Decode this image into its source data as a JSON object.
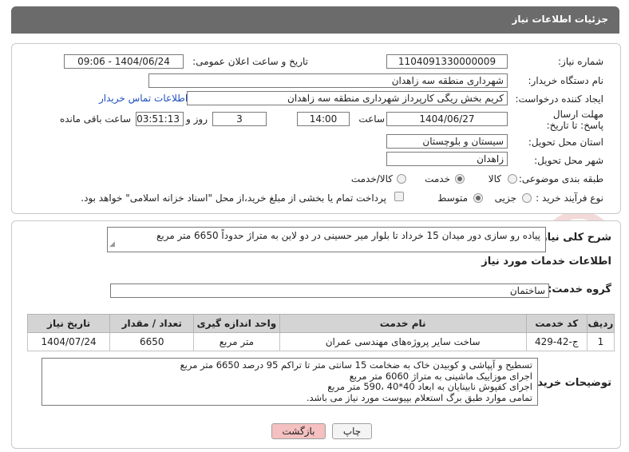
{
  "header": {
    "title": "جزئیات اطلاعات نیاز"
  },
  "form": {
    "need_number_label": "شماره نیاز:",
    "need_number": "1104091330000009",
    "announce_label": "تاریخ و ساعت اعلان عمومی:",
    "announce_value": "1404/06/24 - 09:06",
    "buyer_org_label": "نام دستگاه خریدار:",
    "buyer_org": "شهرداری منطقه سه زاهدان",
    "creator_label": "ایجاد کننده درخواست:",
    "creator": "کریم بخش ریگی کارپرداز شهرداری منطقه سه زاهدان",
    "contact_link": "اطلاعات تماس خریدار",
    "deadline_label": "مهلت ارسال پاسخ: تا تاریخ:",
    "deadline_date": "1404/06/27",
    "time_label": "ساعت",
    "deadline_time": "14:00",
    "days_value": "3",
    "days_label": "روز و",
    "remaining_time": "03:51:13",
    "remaining_label": "ساعت باقی مانده",
    "province_label": "استان محل تحویل:",
    "province": "سیستان و بلوچستان",
    "city_label": "شهر محل تحویل:",
    "city": "زاهدان",
    "category_label": "طبقه بندی موضوعی:",
    "category_options": [
      "کالا",
      "خدمت",
      "کالا/خدمت"
    ],
    "process_label": "نوع فرآیند خرید :",
    "process_options": [
      "جزیی",
      "متوسط"
    ],
    "payment_note": "پرداخت تمام یا بخشی از مبلغ خرید،از محل \"اسناد خزانه اسلامی\" خواهد بود."
  },
  "summary": {
    "label": "شرح کلی نیاز:",
    "text": "پیاده رو سازی دور میدان 15 خرداد تا بلوار میر حسینی در دو لاین به متراژ حدوداً 6650 متر مربع"
  },
  "services": {
    "section_title": "اطلاعات خدمات مورد نیاز",
    "group_label": "گروه خدمت:",
    "group_value": "ساختمان",
    "columns": [
      "ردیف",
      "کد خدمت",
      "نام خدمت",
      "واحد اندازه گیری",
      "تعداد / مقدار",
      "تاریخ نیاز"
    ],
    "rows": [
      {
        "row": "1",
        "code": "ج-42-429",
        "name": "ساخت سایر پروژه‌های مهندسی عمران",
        "unit": "متر مربع",
        "qty": "6650",
        "date": "1404/07/24"
      }
    ]
  },
  "buyer_notes": {
    "label": "توضیحات خریدار:",
    "lines": [
      "تسطیح و آپپاشی و کوبیدن خاک به ضخامت 15 سانتی متر تا تراکم 95 درصد 6650 متر مربع",
      "اجرای موزاییک ماشینی  به متراژ 6060 متر مربع",
      "اجرای کفپوش نابینایان به ابعاد 40*40 ،590 متر مربع",
      "تمامی موارد طبق برگ استعلام بپیوست مورد نیاز می باشد."
    ]
  },
  "buttons": {
    "print": "چاپ",
    "back": "بازگشت"
  },
  "watermark": {
    "text": "AriaTender.neT"
  },
  "colors": {
    "header_bg": "#6b6b6b",
    "link": "#1f4fbf",
    "back_btn": "#f4c0c0",
    "watermark": "#c0392b"
  }
}
